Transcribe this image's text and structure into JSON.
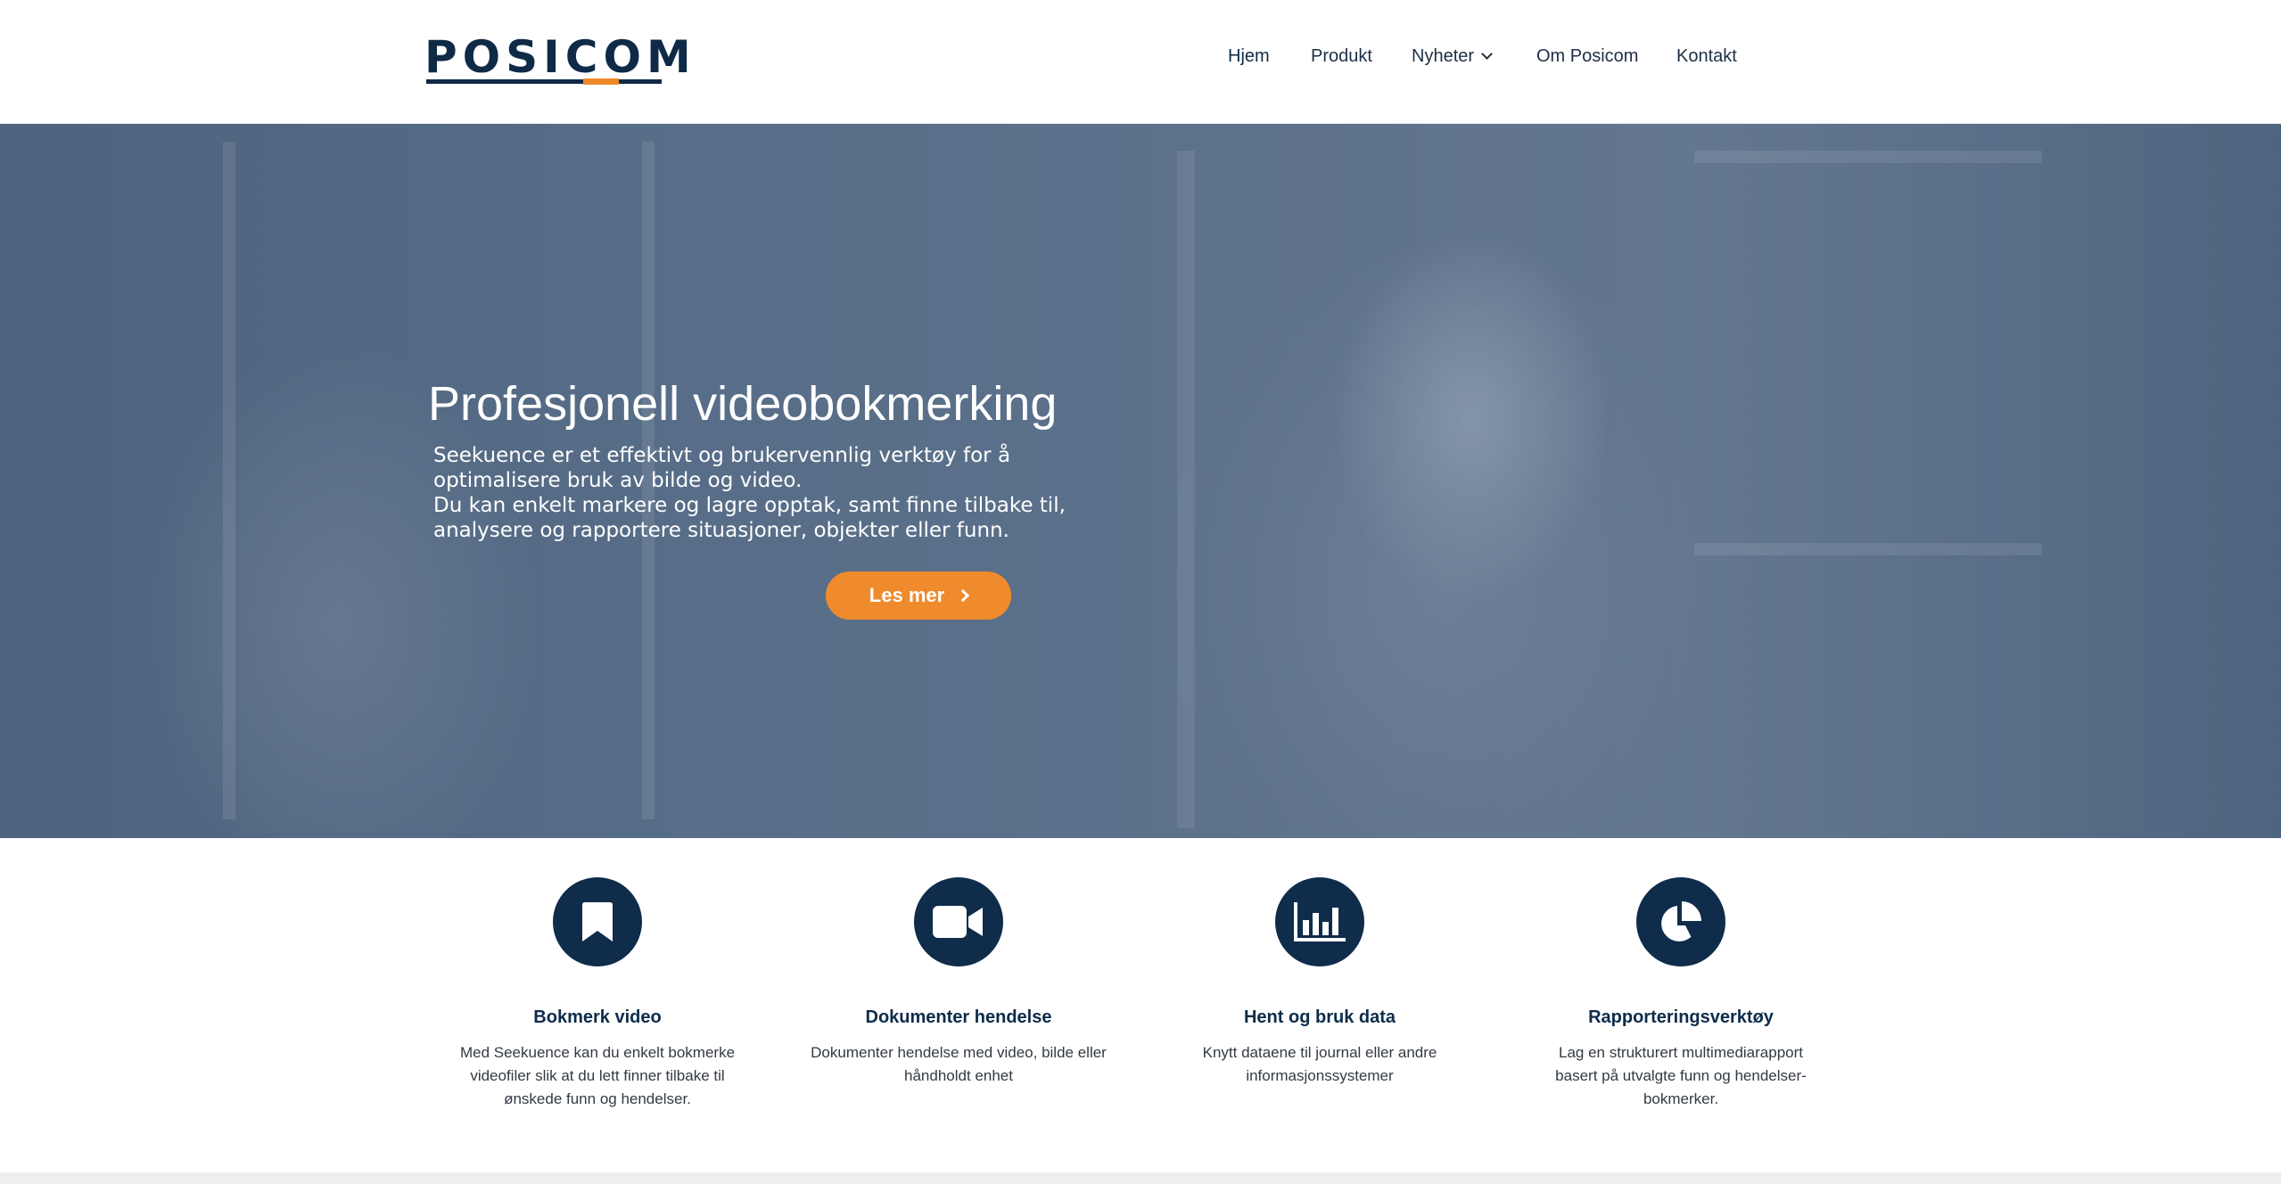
{
  "brand": {
    "logo_text": "POSICOM",
    "primary_color": "#0f2c4b",
    "accent_color": "#ef8b2c"
  },
  "nav": {
    "items": [
      {
        "label": "Hjem",
        "active": true
      },
      {
        "label": "Produkt"
      },
      {
        "label": "Nyheter",
        "has_dropdown": true
      },
      {
        "label": "Om Posicom"
      },
      {
        "label": "Kontakt"
      }
    ]
  },
  "hero": {
    "title": "Profesjonell videobokmerking",
    "lines": [
      "Seekuence er et effektivt og brukervennlig verktøy for å",
      "optimalisere bruk av bilde og video.",
      "Du kan enkelt markere og lagre opptak, samt finne tilbake til,",
      "analysere og rapportere situasjoner, objekter eller funn."
    ],
    "button_label": "Les mer"
  },
  "features": [
    {
      "icon": "bookmark-icon",
      "title": "Bokmerk video",
      "desc_lines": [
        "Med Seekuence kan du enkelt bokmerke",
        "videofiler slik at du lett finner tilbake til",
        "ønskede funn og hendelser."
      ]
    },
    {
      "icon": "video-camera-icon",
      "title": "Dokumenter hendelse",
      "desc_lines": [
        "Dokumenter hendelse med video, bilde eller",
        "håndholdt enhet"
      ]
    },
    {
      "icon": "bar-chart-icon",
      "title": "Hent og bruk data",
      "desc_lines": [
        "Knytt dataene til journal eller andre",
        "informasjonssystemer"
      ]
    },
    {
      "icon": "pie-chart-icon",
      "title": "Rapporteringsverktøy",
      "desc_lines": [
        "Lag en strukturert multimediarapport",
        "basert på utvalgte funn og hendelser-",
        "bokmerker."
      ]
    }
  ]
}
